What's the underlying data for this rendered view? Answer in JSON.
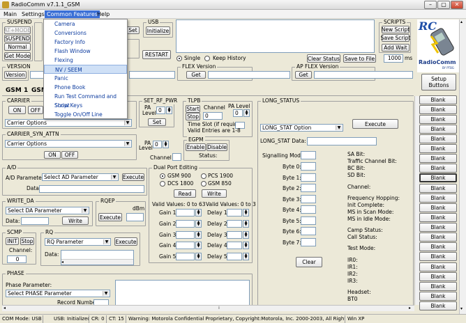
{
  "window": {
    "title": "RadioComm v7.1.1_GSM",
    "minimize": "–",
    "maximize": "▢",
    "close": "✕"
  },
  "menubar": {
    "items": [
      "Main",
      "Settings",
      "Common Features",
      "Help"
    ]
  },
  "dropdown": {
    "items": [
      "Camera",
      "Conversions",
      "Factory Info",
      "Flash Window",
      "Flexing",
      "NV / SEEM",
      "Panic",
      "Phone Book",
      "Run Test Command and Script",
      "Show Keys",
      "Toggle On/Off Line"
    ],
    "highlighted": "NV / SEEM"
  },
  "suspend": {
    "label": "SUSPEND",
    "at_mode": "AT+MODE",
    "suspend": "SUSPEND",
    "normal": "Normal",
    "get_mode": "Get Mode"
  },
  "set_btn": "Set",
  "usb": {
    "label": "USB",
    "initialize": "Initialize",
    "restart": "RESTART"
  },
  "history": {
    "single": "Single",
    "keep": "Keep History",
    "clear_status": "Clear Status",
    "save_to_file": "Save to File",
    "ms_value": "1000",
    "ms_unit": "ms"
  },
  "scripts": {
    "label": "SCRIPTS",
    "new": "New Script",
    "save": "Save Script",
    "add_wait": "Add Wait"
  },
  "logo": {
    "letters": "RC",
    "name": "RadioComm",
    "by": "BY PTBG"
  },
  "version": {
    "label": "VERSION",
    "button": "Version"
  },
  "flex_version": {
    "label": "FLEX Version",
    "get": "Get"
  },
  "ap_flex_version": {
    "label": "AP FLEX Version",
    "get": "Get"
  },
  "setup_buttons": "Setup Buttons",
  "tabs": {
    "gsm1": "GSM 1",
    "gsm2": "GSM"
  },
  "carrier": {
    "label": "CARRIER",
    "on": "ON",
    "off": "OFF",
    "options": "Carrier Options"
  },
  "set_rf_pwr": {
    "label": "SET_RF_PWR",
    "pa": "PA",
    "level": "Level",
    "value": "0",
    "set": "Set"
  },
  "tlpb": {
    "label": "TLPB",
    "start": "Start",
    "stop": "Stop",
    "channel": "Channel",
    "channel_value": "0",
    "pa_level": "PA Level",
    "pa_value": "0",
    "time_slot": "Time Slot (if required)",
    "valid": "Valid Entries are 1-8"
  },
  "carrier_syn_attn": {
    "label": "CARRIER_SYN_ATTN",
    "options": "Carrier Options",
    "on": "ON",
    "off": "OFF",
    "pa": "PA",
    "level": "Level",
    "value": "0",
    "channel": "Channel"
  },
  "egpm": {
    "label": "EGPM",
    "enable": "Enable",
    "disable": "Disable",
    "status": "Status:"
  },
  "ad": {
    "label": "A/D",
    "param_label": "A/D Parameter",
    "param": "Select AD Parameter",
    "execute": "Execute",
    "data": "Data"
  },
  "dual_port": {
    "label": "Dual Port Editing",
    "gsm900": "GSM 900",
    "pcs1900": "PCS 1900",
    "dcs1800": "DCS 1800",
    "gsm850": "GSM 850",
    "read": "Read",
    "write": "Write",
    "valid_gain": "Valid Values: 0 to 63",
    "valid_delay": "Valid Values: 0 to 3",
    "gains": [
      "Gain 1:",
      "Gain 2:",
      "Gain 3:",
      "Gain 4:",
      "Gain 5:"
    ],
    "delays": [
      "Delay 1:",
      "Delay 2:",
      "Delay 3:",
      "Delay 4:",
      "Delay 5:"
    ]
  },
  "write_da": {
    "label": "WRITE_DA",
    "param": "Select DA Parameter",
    "data": "Data:",
    "write": "Write"
  },
  "rqep": {
    "label": "RQEP",
    "dbm": "dBm",
    "execute": "Execute"
  },
  "scmp": {
    "label": "SCMP",
    "init": "INIT",
    "stop": "Stop",
    "channel": "Channel:",
    "value": "0"
  },
  "rq": {
    "label": "RQ",
    "param": "RQ Parameter",
    "execute": "Execute",
    "data": "Data:"
  },
  "phase": {
    "label": "PHASE",
    "param_label": "Phase Parameter:",
    "param": "Select PHASE Parameter",
    "record": "Record Number"
  },
  "long_status": {
    "label": "LONG_STATUS",
    "option": "LONG_STAT Option",
    "execute": "Execute",
    "data_label": "LONG_STAT Data:",
    "signalling": "Signalling Mode:",
    "bytes": [
      "Byte 0:",
      "Byte 1:",
      "Byte 2:",
      "Byte 3:",
      "Byte 4:",
      "Byte 5:",
      "Byte 6:",
      "Byte 7:"
    ],
    "clear": "Clear",
    "right_labels": [
      "SA Bit:",
      "Traffic Channel Bit:",
      "BC Bit:",
      "SD Bit:",
      "Channel:",
      "Frequency Hopping:",
      "Init Complete:",
      "MS in Scan Mode:",
      "MS in Idle Mode:",
      "Camp Status:",
      "Call Status:",
      "Test Mode:",
      "IR0:",
      "IR1:",
      "IR2:",
      "IR3:",
      "Headset:",
      "BT0"
    ]
  },
  "blank_buttons": [
    "Blank",
    "Blank",
    "Blank",
    "Blank",
    "Blank",
    "Blank",
    "Blank",
    "Blank",
    "Blank",
    "Blank",
    "Blank",
    "Blank",
    "Blank",
    "Blank",
    "Blank",
    "Blank",
    "Blank",
    "Blank",
    "Blank",
    "Blank",
    "Blank",
    "Blank"
  ],
  "statusbar": [
    "COM Mode: USB",
    "USB: Initialized",
    "CR: 0",
    "CT: 15",
    "Warning: Motorola Confidential Proprietary, Copyright:Motorola, Inc. 2000-2003, All Rights Reserved",
    "Win XP"
  ]
}
